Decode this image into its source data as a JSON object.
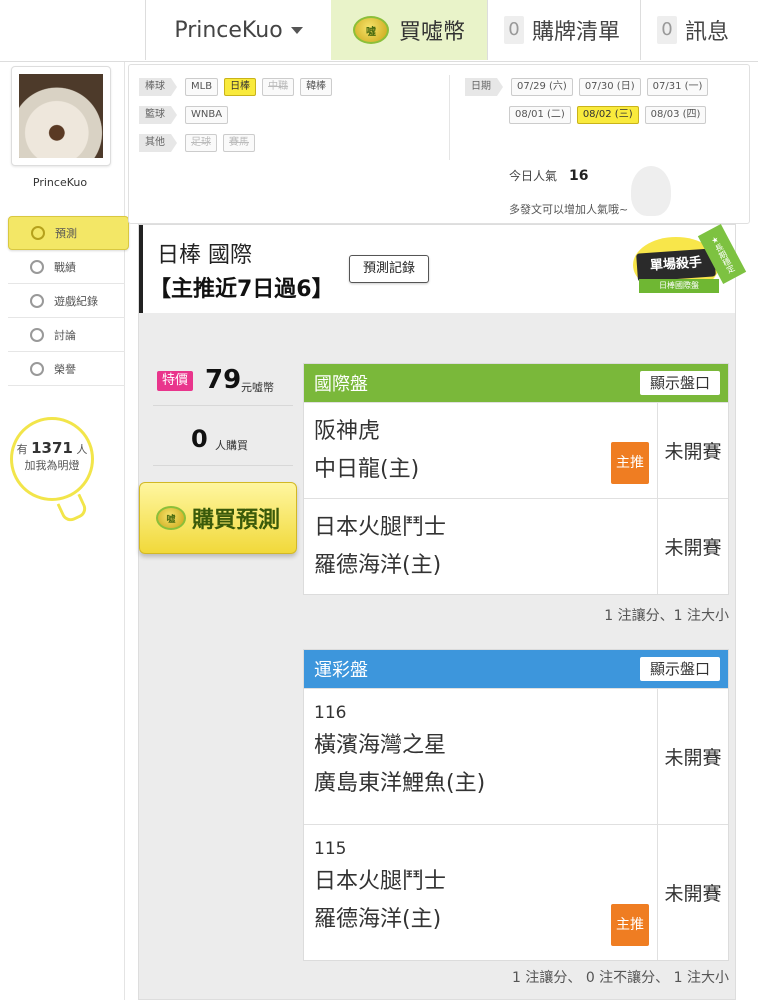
{
  "topbar": {
    "username": "PrinceKuo",
    "buy_coin_label": "買噓幣",
    "coin_icon_text": "噓",
    "list_count": "0",
    "list_label": "購牌清單",
    "msg_count": "0",
    "msg_label": "訊息"
  },
  "sidebar": {
    "username": "PrinceKuo",
    "items": [
      {
        "label": "預測",
        "icon": "target-icon"
      },
      {
        "label": "戰績",
        "icon": "chat-icon"
      },
      {
        "label": "遊戲紀錄",
        "icon": "circle-icon"
      },
      {
        "label": "討論",
        "icon": "discuss-icon"
      },
      {
        "label": "榮譽",
        "icon": "medal-icon"
      }
    ],
    "bulb": {
      "prefix": "有",
      "count": "1371",
      "suffix": "人",
      "text": "加我為明燈"
    }
  },
  "filters": {
    "baseball_label": "棒球",
    "baseball": [
      "MLB",
      "日棒",
      "中職",
      "韓棒"
    ],
    "basketball_label": "籃球",
    "basketball": [
      "WNBA"
    ],
    "other_label": "其他",
    "other": [
      "足球",
      "賽馬"
    ],
    "date_label": "日期",
    "dates_row1": [
      "07/29 (六)",
      "07/30 (日)",
      "07/31 (一)"
    ],
    "dates_row2": [
      "08/01 (二)",
      "08/02 (三)",
      "08/03 (四)"
    ],
    "popularity_label": "今日人氣",
    "popularity_value": "16",
    "hint": "多發文可以增加人氣哦~"
  },
  "header": {
    "title": "日棒 國際",
    "subtitle": "【主推近7日過6】",
    "record_button": "預測記錄",
    "badge_main": "單場殺手",
    "badge_sub": "日棒國際盤",
    "badge_ribbon": "★長期穩定"
  },
  "purchase": {
    "special_tag": "特價",
    "price": "79",
    "price_unit": "元噓幣",
    "buyers": "0",
    "buyers_unit": "人購買",
    "buy_button": "購買預測"
  },
  "markets": {
    "intl": {
      "title": "國際盤",
      "show_button": "顯示盤口",
      "matches": [
        {
          "away": "阪神虎",
          "home": "中日龍(主)",
          "status": "未開賽",
          "tag": "主推"
        },
        {
          "away": "日本火腿鬥士",
          "home": "羅德海洋(主)",
          "status": "未開賽",
          "tag": ""
        }
      ],
      "summary": "1 注讓分、1 注大小"
    },
    "lottery": {
      "title": "運彩盤",
      "show_button": "顯示盤口",
      "matches": [
        {
          "num": "116",
          "away": "橫濱海灣之星",
          "home": "廣島東洋鯉魚(主)",
          "status": "未開賽",
          "tag": ""
        },
        {
          "num": "115",
          "away": "日本火腿鬥士",
          "home": "羅德海洋(主)",
          "status": "未開賽",
          "tag": "主推"
        }
      ],
      "summary": "1 注讓分、 0 注不讓分、 1 注大小"
    }
  },
  "colors": {
    "intl_header": "#7ab83a",
    "lottery_header": "#3d96dc",
    "main_tag": "#ef7d22",
    "special_tag": "#e9358c",
    "accent_yellow": "#f9ea3c"
  }
}
